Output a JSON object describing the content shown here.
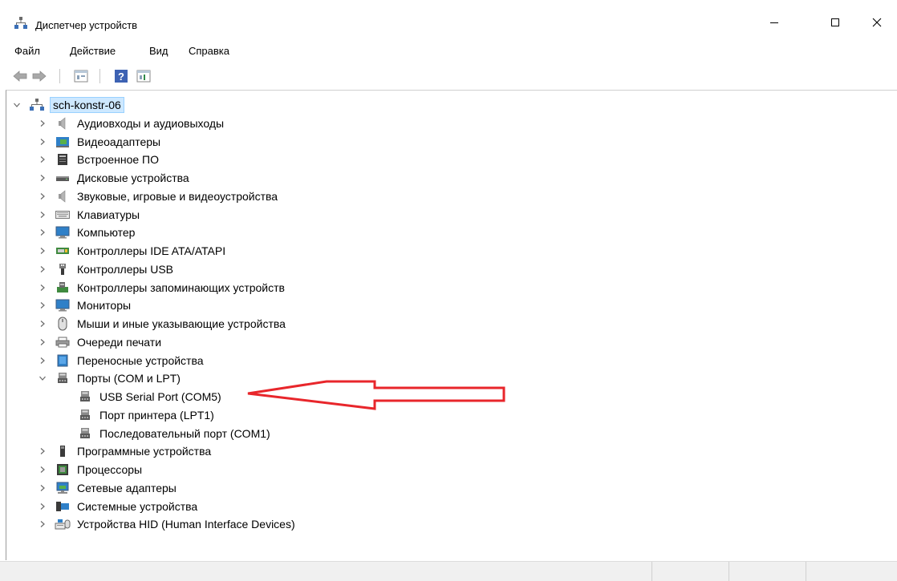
{
  "window": {
    "title": "Диспетчер устройств",
    "icon": "device-manager-icon"
  },
  "menu": [
    "Файл",
    "Действие",
    "Вид",
    "Справка"
  ],
  "toolbar": {
    "icons": [
      "back-arrow-icon",
      "forward-arrow-icon",
      "properties-icon",
      "help-icon",
      "show-hidden-icon"
    ]
  },
  "tree": {
    "root": "sch-konstr-06",
    "categories": [
      {
        "label": "Аудиовходы и аудиовыходы",
        "icon": "speaker-icon"
      },
      {
        "label": "Видеоадаптеры",
        "icon": "display-adapter-icon"
      },
      {
        "label": "Встроенное ПО",
        "icon": "firmware-icon"
      },
      {
        "label": "Дисковые устройства",
        "icon": "disk-drive-icon"
      },
      {
        "label": "Звуковые, игровые и видеоустройства",
        "icon": "speaker-icon"
      },
      {
        "label": "Клавиатуры",
        "icon": "keyboard-icon"
      },
      {
        "label": "Компьютер",
        "icon": "computer-icon"
      },
      {
        "label": "Контроллеры IDE ATA/ATAPI",
        "icon": "ide-controller-icon"
      },
      {
        "label": "Контроллеры USB",
        "icon": "usb-icon"
      },
      {
        "label": "Контроллеры запоминающих устройств",
        "icon": "storage-controller-icon"
      },
      {
        "label": "Мониторы",
        "icon": "monitor-icon"
      },
      {
        "label": "Мыши и иные указывающие устройства",
        "icon": "mouse-icon"
      },
      {
        "label": "Очереди печати",
        "icon": "printer-icon"
      },
      {
        "label": "Переносные устройства",
        "icon": "portable-device-icon"
      },
      {
        "label": "Порты (COM и LPT)",
        "icon": "port-icon",
        "expanded": true,
        "children": [
          "USB Serial Port (COM5)",
          "Порт принтера (LPT1)",
          "Последовательный порт (COM1)"
        ]
      },
      {
        "label": "Программные устройства",
        "icon": "software-device-icon"
      },
      {
        "label": "Процессоры",
        "icon": "processor-icon"
      },
      {
        "label": "Сетевые адаптеры",
        "icon": "network-adapter-icon"
      },
      {
        "label": "Системные устройства",
        "icon": "system-device-icon"
      },
      {
        "label": "Устройства HID (Human Interface Devices)",
        "icon": "hid-icon"
      }
    ]
  },
  "annotation": {
    "type": "red-arrow",
    "points_to": "USB Serial Port (COM5)",
    "color": "#e8262b"
  },
  "colors": {
    "selection_bg": "#cde8ff",
    "selection_border": "#99d1ff",
    "statusbar_bg": "#f0f0f0"
  }
}
